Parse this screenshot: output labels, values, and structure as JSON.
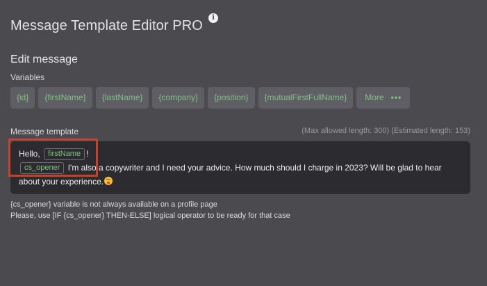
{
  "app": {
    "title": "Message Template Editor PRO"
  },
  "info_icon": {
    "glyph": "i",
    "name": "info-icon"
  },
  "section": {
    "title": "Edit message"
  },
  "variables": {
    "label": "Variables",
    "chips": [
      "{id}",
      "{firstName}",
      "{lastName}",
      "{company}",
      "{position}",
      "{mutualFirstFullName}"
    ],
    "more": {
      "label": "More",
      "icon": "more-dots-icon",
      "glyph": "•••"
    }
  },
  "template": {
    "label": "Message template",
    "limits": "(Max allowed length: 300) (Estimated length: 153)",
    "greeting": "Hello,",
    "tag_first_name": "firstName",
    "exclaim": "!",
    "tag_cs_opener": "cs_opener",
    "body": " I'm also a copywriter and I need your advice. How much should I charge in 2023? Will be glad to hear about your experience.",
    "emoji": "tongue-wink-emoji"
  },
  "notes": [
    "{cs_opener} variable is not always available on a profile page",
    "Please, use [IF {cs_opener} THEN-ELSE] logical operator to be ready for that case"
  ],
  "colors": {
    "background": "#4a4a4f",
    "editor_background": "#2c2c30",
    "chip_background": "#5e5e64",
    "variable_text": "#7ec47e",
    "highlight_border": "#c6432b"
  }
}
